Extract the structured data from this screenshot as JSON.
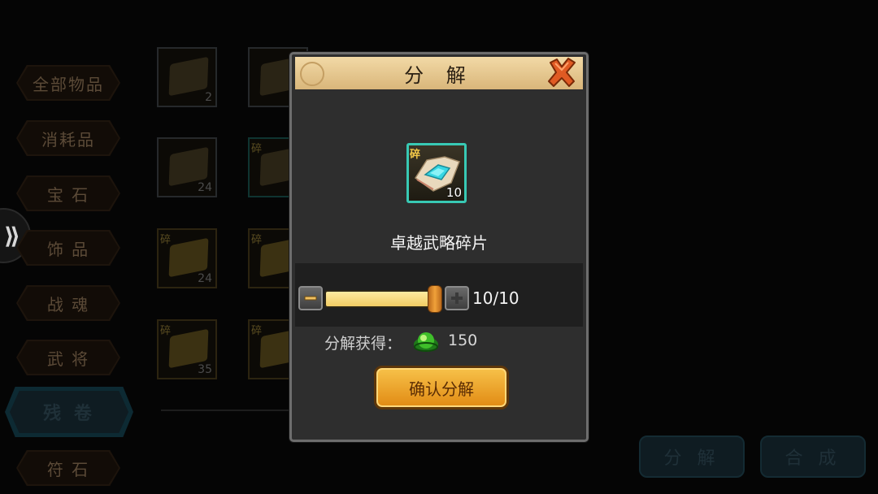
{
  "categories": {
    "all": "全部物品",
    "consumables": "消耗品",
    "gems": "宝 石",
    "accessories": "饰 品",
    "war_soul": "战 魂",
    "generals": "武 将",
    "scrolls": "残 卷",
    "runes": "符 石"
  },
  "grid": {
    "fragment_tag": "碎",
    "slots": [
      {
        "count": "2",
        "fragment": false
      },
      {
        "count": "24",
        "fragment": false
      },
      {
        "count": "24",
        "fragment": true
      },
      {
        "count": "35",
        "fragment": true
      }
    ]
  },
  "bottom_buttons": {
    "decompose": "分 解",
    "synthesize": "合 成"
  },
  "modal": {
    "title": "分 解",
    "item": {
      "tag": "碎",
      "count": "10",
      "name": "卓越武略碎片"
    },
    "slider": {
      "value": 10,
      "max": 10,
      "display": "10/10"
    },
    "reward_label": "分解获得：",
    "reward_amount": "150",
    "confirm_label": "确认分解"
  },
  "colors": {
    "accent_teal": "#38c9b4",
    "confirm_gold": "#f7c24a",
    "title_parchment": "#f2d9a6"
  },
  "icons": {
    "close": "close-x-icon",
    "reward": "green-gem-icon",
    "minus": "minus-icon",
    "plus": "plus-icon"
  }
}
